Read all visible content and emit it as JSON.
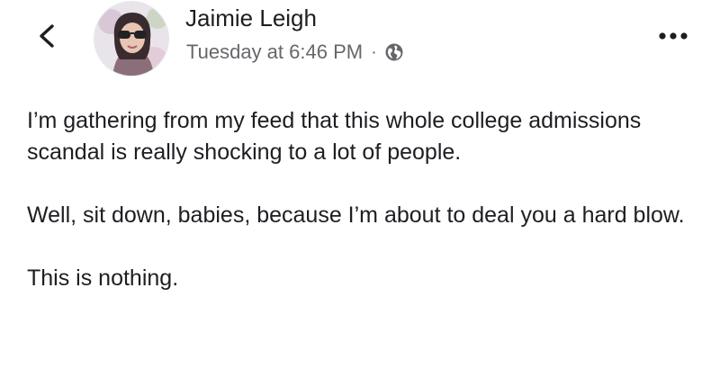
{
  "header": {
    "back_icon": "chevron-left-icon",
    "author_name": "Jaimie Leigh",
    "timestamp": "Tuesday at 6:46 PM",
    "separator": "·",
    "privacy_icon": "globe-icon",
    "more_icon": "ellipsis-icon"
  },
  "post": {
    "paragraphs": [
      "I’m gathering from my feed that this whole college admissions scandal is really shocking to a lot of people.",
      "Well, sit down, babies, because I’m about to deal you a hard blow.",
      "This is nothing."
    ]
  }
}
